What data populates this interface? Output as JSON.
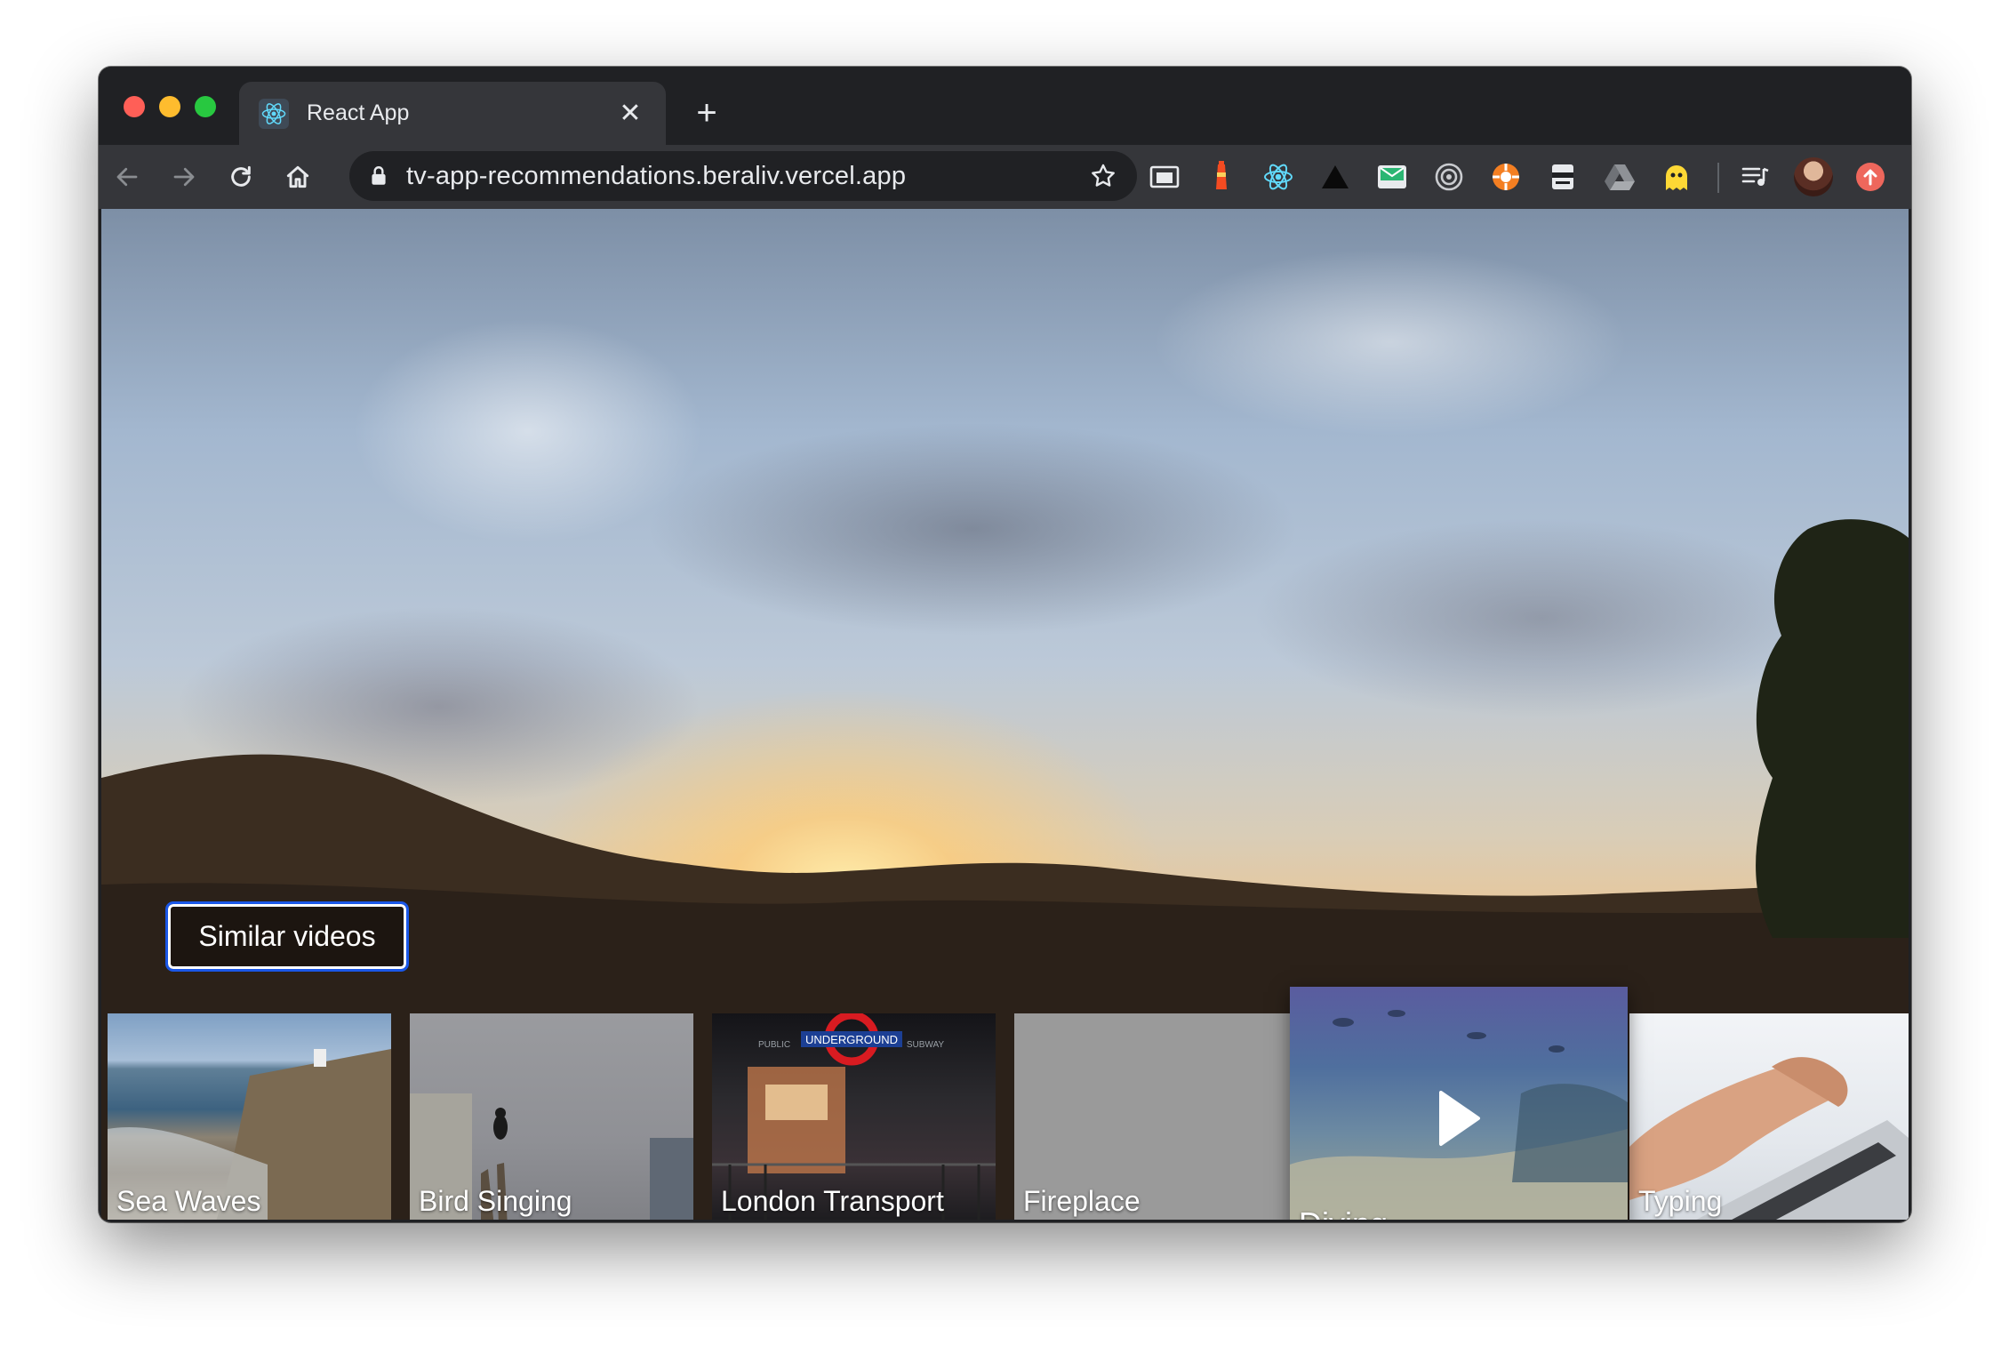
{
  "browser": {
    "tab_title": "React App",
    "tab_close": "✕",
    "new_tab": "+",
    "url": "tv-app-recommendations.beraliv.vercel.app"
  },
  "page": {
    "similar_button": "Similar videos",
    "videos": [
      {
        "label": "Sea Waves"
      },
      {
        "label": "Bird Singing"
      },
      {
        "label": "London Transport"
      },
      {
        "label": "Fireplace"
      },
      {
        "label": "Diving",
        "focused": true
      },
      {
        "label": "Typing"
      }
    ],
    "london_sign": "UNDERGROUND",
    "london_sign_left": "PUBLIC",
    "london_sign_right": "SUBWAY"
  }
}
